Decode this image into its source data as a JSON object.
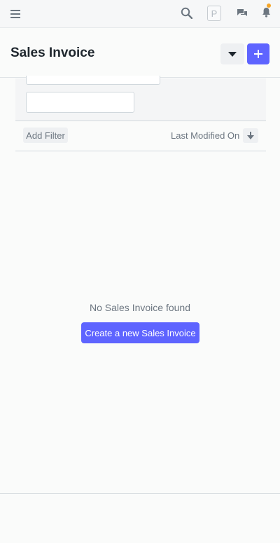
{
  "navbar": {
    "menu_icon": "hamburger-icon",
    "search_icon": "search-icon",
    "avatar_letter": "P",
    "chat_icon": "chat-icon",
    "bell_icon": "bell-icon",
    "notification_color": "#f6a526"
  },
  "header": {
    "title": "Sales Invoice",
    "dropdown_icon": "caret-down-icon",
    "add_icon": "plus-icon"
  },
  "filters": {
    "field1_value": "",
    "field2_value": "",
    "add_filter_label": "Add Filter",
    "sort_label": "Last Modified On",
    "sort_icon": "sort-descending-icon"
  },
  "empty_state": {
    "message": "No Sales Invoice found",
    "create_label": "Create a new Sales Invoice"
  },
  "colors": {
    "primary": "#5e64ff",
    "text": "#36414c",
    "muted": "#6c7680"
  }
}
